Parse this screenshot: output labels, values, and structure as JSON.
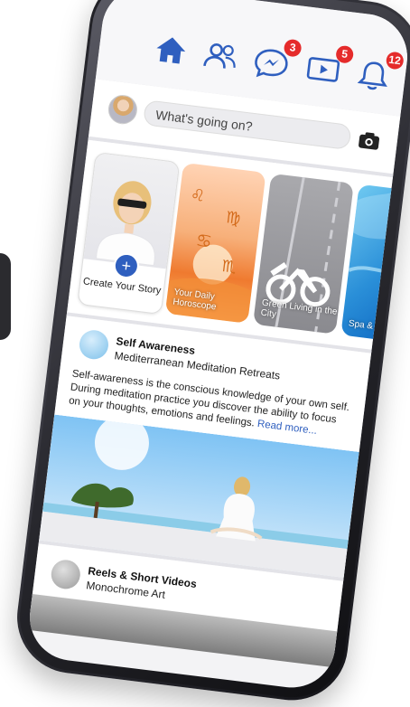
{
  "colors": {
    "accent": "#2f5fbf",
    "badge": "#e52b2b"
  },
  "nav": {
    "icons": [
      {
        "name": "home-icon"
      },
      {
        "name": "friends-icon"
      },
      {
        "name": "messenger-icon",
        "badge": "3"
      },
      {
        "name": "video-icon",
        "badge": "5"
      },
      {
        "name": "bell-icon",
        "badge": "12"
      }
    ]
  },
  "composer": {
    "placeholder": "What's going on?"
  },
  "stories": [
    {
      "label": "Create Your Story"
    },
    {
      "label": "Your Daily Horoscope"
    },
    {
      "label": "Green Living in the City"
    },
    {
      "label": "Spa & Treatm"
    }
  ],
  "post": {
    "title": "Self Awareness",
    "subtitle": "Mediterranean Meditation Retreats",
    "text": "Self-awareness is the conscious knowledge of your own self. During meditation practice you discover the ability to focus on your thoughts, emotions and feelings.",
    "read_more": "Read more..."
  },
  "reels": {
    "title": "Reels & Short Videos",
    "subtitle": "Monochrome Art"
  }
}
